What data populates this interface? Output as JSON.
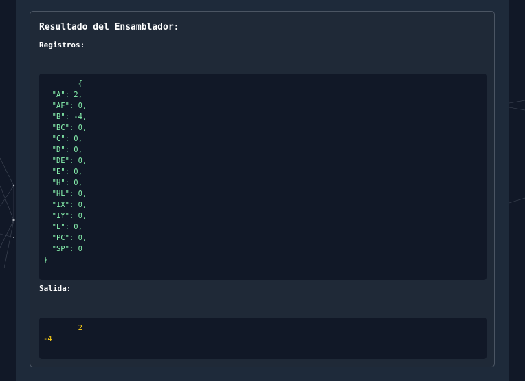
{
  "result": {
    "title": "Resultado del Ensamblador:",
    "registers_label": "Registros:",
    "registers_json": "        {\n  \"A\": 2,\n  \"AF\": 0,\n  \"B\": -4,\n  \"BC\": 0,\n  \"C\": 0,\n  \"D\": 0,\n  \"DE\": 0,\n  \"E\": 0,\n  \"H\": 0,\n  \"HL\": 0,\n  \"IX\": 0,\n  \"IY\": 0,\n  \"L\": 0,\n  \"PC\": 0,\n  \"SP\": 0\n}",
    "output_label": "Salida:",
    "output_text": "        2\n-4"
  },
  "colors": {
    "page_background": "#111827",
    "card_background": "#1f2937",
    "code_background": "#111827",
    "register_text": "#86efac",
    "output_text": "#facc15"
  }
}
